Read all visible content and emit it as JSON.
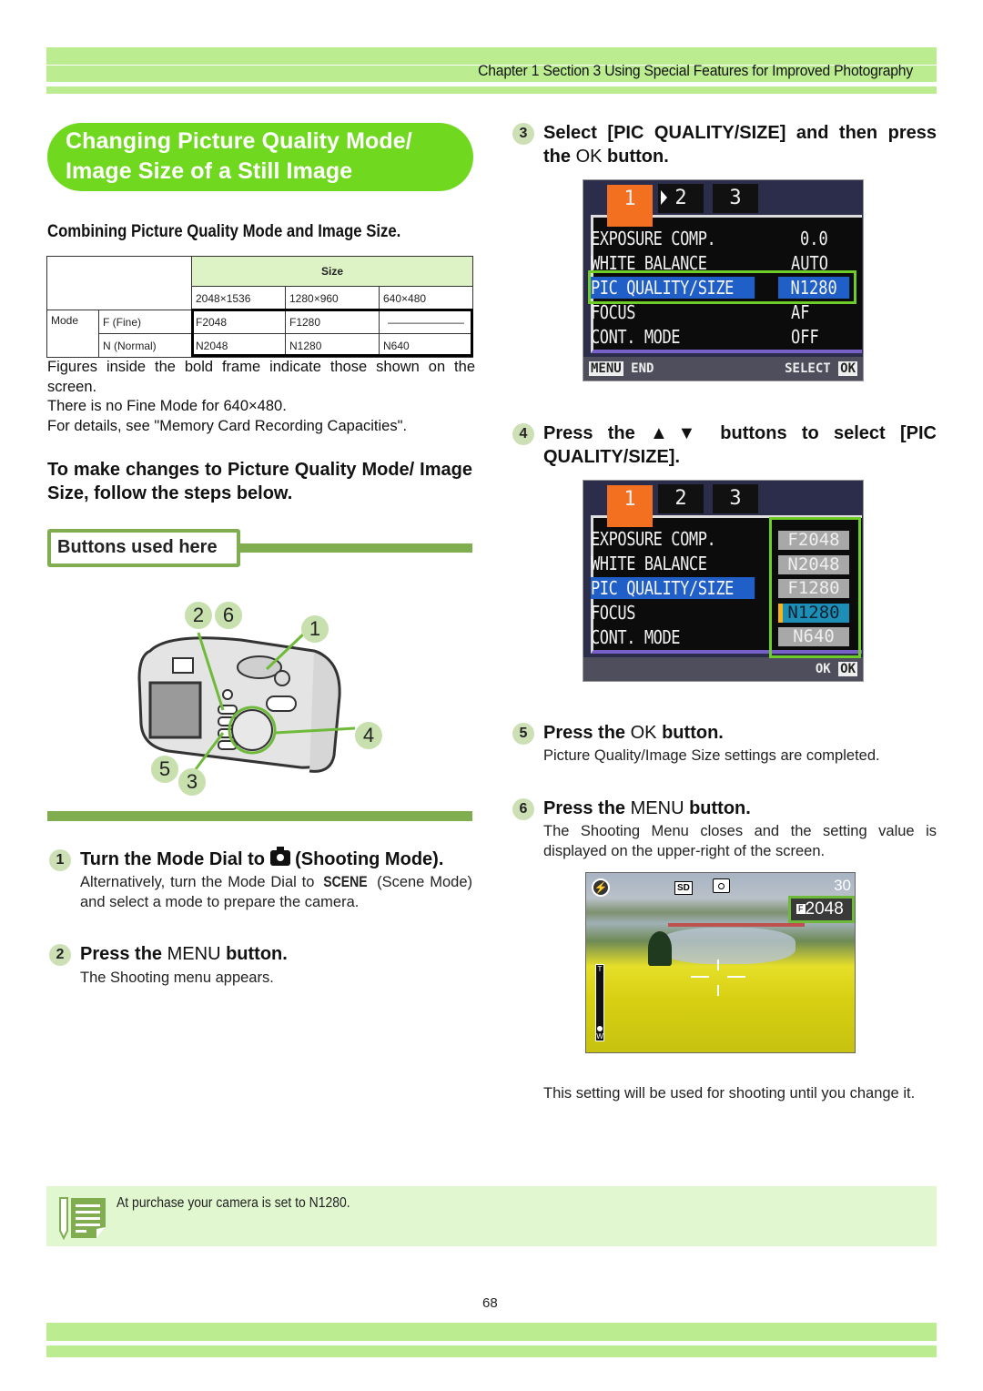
{
  "header": {
    "chapter_title": "Chapter 1 Section 3 Using Special Features for Improved Photography",
    "band_color": "#bcec90"
  },
  "section": {
    "title_line1": "Changing Picture Quality Mode/",
    "title_line2": "Image Size of a Still Image",
    "title_bg": "#70d91f",
    "subheading": "Combining Picture Quality Mode and Image Size."
  },
  "quality_table": {
    "size_header": "Size",
    "size_columns": [
      "2048×1536",
      "1280×960",
      "640×480"
    ],
    "mode_label": "Mode",
    "rows": [
      {
        "mode": "F (Fine)",
        "values": [
          "F2048",
          "F1280",
          "———————"
        ]
      },
      {
        "mode": "N (Normal)",
        "values": [
          "N2048",
          "N1280",
          "N640"
        ]
      }
    ]
  },
  "notes": [
    "Figures inside the bold frame indicate those shown on the screen.",
    "There is no Fine Mode for 640×480.",
    "For details, see \"Memory Card Recording Capacities\"."
  ],
  "instructions_heading": "To make changes to Picture Quality Mode/ Image Size, follow the steps below.",
  "buttons_used": {
    "label": "Buttons used here",
    "accent": "#7fad50",
    "callouts": [
      "2",
      "6",
      "1",
      "4",
      "5",
      "3"
    ]
  },
  "steps": [
    {
      "num": "1",
      "title_pre": "Turn the Mode Dial to",
      "title_icon": "camera-icon",
      "title_post": "(Shooting Mode).",
      "body_pre": "Alternatively, turn the Mode Dial to",
      "body_bold": "SCENE",
      "body_post": "(Scene Mode) and select a mode to prepare the camera."
    },
    {
      "num": "2",
      "title_pre": "Press the",
      "title_key": "MENU",
      "title_post": "button.",
      "body": "The Shooting menu appears."
    },
    {
      "num": "3",
      "title_pre": "Select [PIC QUALITY/SIZE] and then press the",
      "title_key": "OK",
      "title_post": "button."
    },
    {
      "num": "4",
      "title_pre": "Press the",
      "title_arrows": "▲▼",
      "title_post": "buttons to select [PIC QUALITY/SIZE]."
    },
    {
      "num": "5",
      "title_pre": "Press the",
      "title_key": "OK",
      "title_post": "button.",
      "body": "Picture Quality/Image Size settings are completed."
    },
    {
      "num": "6",
      "title_pre": "Press the",
      "title_key": "MENU",
      "title_post": "button.",
      "body": "The Shooting Menu closes and the setting value is displayed on the upper-right of the screen."
    }
  ],
  "lcd_menu_1": {
    "tabs": [
      "1",
      "2",
      "3"
    ],
    "items": [
      {
        "label": "EXPOSURE COMP.",
        "value": "0.0"
      },
      {
        "label": "WHITE BALANCE",
        "value": "AUTO"
      },
      {
        "label": "PIC QUALITY/SIZE",
        "value": "N1280",
        "selected": true
      },
      {
        "label": "FOCUS",
        "value": "AF"
      },
      {
        "label": "CONT. MODE",
        "value": "OFF"
      }
    ],
    "footer_left_key": "MENU",
    "footer_left": "END",
    "footer_right": "SELECT",
    "footer_right_key": "OK"
  },
  "lcd_menu_2": {
    "tabs": [
      "1",
      "2",
      "3"
    ],
    "items": [
      "EXPOSURE COMP.",
      "WHITE BALANCE",
      "PIC QUALITY/SIZE",
      "FOCUS",
      "CONT. MODE"
    ],
    "options": [
      "F2048",
      "N2048",
      "F1280",
      "N1280",
      "N640"
    ],
    "selected_option": "N1280",
    "footer_right": "OK",
    "footer_right_key": "OK"
  },
  "live_view": {
    "sd_label": "SD",
    "shots_remaining": "30",
    "quality_badge": "F",
    "quality_value": "2048",
    "zoom_t": "T",
    "zoom_w": "W"
  },
  "closing_note": "This setting will be used for shooting until you change it.",
  "tip": {
    "text": "At purchase your camera is set to N1280.",
    "bg": "#e1f7d0"
  },
  "page_number": "68"
}
